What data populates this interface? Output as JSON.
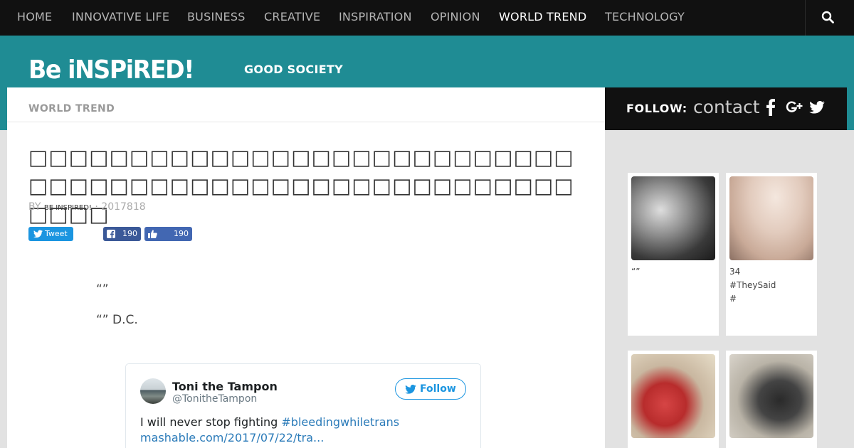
{
  "nav": {
    "items": [
      "HOME",
      "INNOVATIVE LIFE",
      "BUSINESS",
      "CREATIVE",
      "INSPIRATION",
      "OPINION",
      "WORLD TREND",
      "TECHNOLOGY"
    ],
    "active": "WORLD TREND"
  },
  "header": {
    "logo": "Be iNSPiRED!",
    "tagline": "GOOD SOCIETY"
  },
  "follow": {
    "label": "FOLLOW:",
    "contact": "contact",
    "icons": [
      "facebook-icon",
      "google-plus-icon",
      "twitter-icon"
    ]
  },
  "article": {
    "category": "WORLD TREND",
    "title": "□□□□□□□□□□□□□□□□□□□□□□□□□□□□□□□□□□□□□□□□□□□□□□□□□□□□□□□□□□",
    "by": "BY",
    "author": "BE INSPIRED!",
    "date": "· 2017818",
    "share": {
      "tweet_label": "Tweet",
      "fb_count": "190",
      "like_count": "190"
    },
    "paragraphs": [
      "“”",
      "“” D.C."
    ]
  },
  "tweet": {
    "name": "Toni the Tampon",
    "handle": "@TonitheTampon",
    "follow_label": "Follow",
    "text": "I will never stop fighting ",
    "hashtag": "#bleedingwhiletrans",
    "link": "mashable.com/2017/07/22/tra..."
  },
  "sidebar": {
    "cards": [
      {
        "caption": [
          "“”"
        ]
      },
      {
        "caption": [
          "34",
          "#TheySaid",
          "#"
        ]
      },
      {
        "caption": []
      },
      {
        "caption": []
      }
    ]
  },
  "colors": {
    "teal": "#1f8c94",
    "nav_bg": "#111111",
    "twitter": "#1b95e0",
    "facebook": "#3b5998"
  }
}
